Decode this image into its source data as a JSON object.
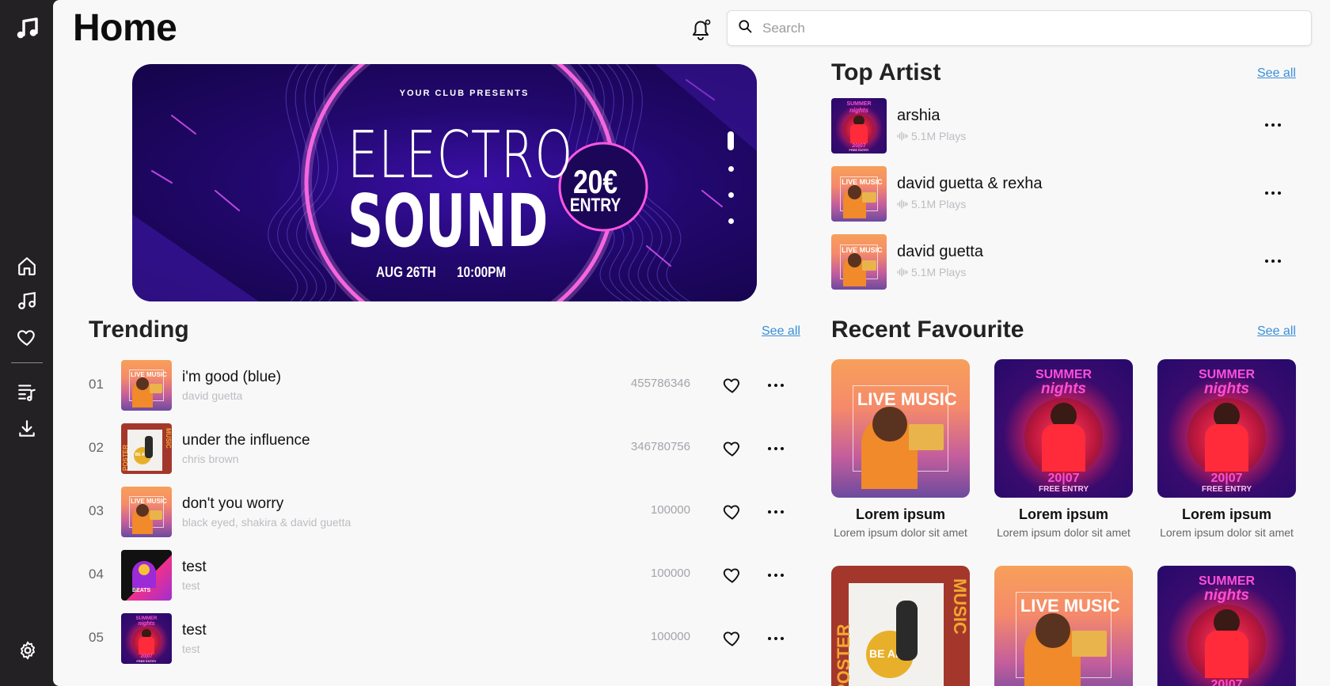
{
  "app": {
    "title": "Home"
  },
  "search": {
    "placeholder": "Search"
  },
  "banner": {
    "presents": "YOUR CLUB PRESENTS",
    "line1": "ELECTRO",
    "line2": "SOUND",
    "price": "20€",
    "entry": "ENTRY",
    "date": "AUG 26TH",
    "time": "10:00PM"
  },
  "trending": {
    "title": "Trending",
    "see_all": "See all",
    "items": [
      {
        "num": "01",
        "title": "i'm good (blue)",
        "artist": "david guetta",
        "plays": "455786346",
        "art": "live"
      },
      {
        "num": "02",
        "title": "under the influence",
        "artist": "chris brown",
        "plays": "346780756",
        "art": "poster"
      },
      {
        "num": "03",
        "title": "don't you worry",
        "artist": "black eyed, shakira & david guetta",
        "plays": "100000",
        "art": "live"
      },
      {
        "num": "04",
        "title": "test",
        "artist": "test",
        "plays": "100000",
        "art": "beats"
      },
      {
        "num": "05",
        "title": "test",
        "artist": "test",
        "plays": "100000",
        "art": "summer"
      }
    ]
  },
  "top_artist": {
    "title": "Top Artist",
    "see_all": "See all",
    "items": [
      {
        "name": "arshia",
        "plays": "5.1M Plays",
        "art": "summer"
      },
      {
        "name": "david guetta & rexha",
        "plays": "5.1M Plays",
        "art": "live"
      },
      {
        "name": "david guetta",
        "plays": "5.1M Plays",
        "art": "live"
      }
    ]
  },
  "recent_favourite": {
    "title": "Recent Favourite",
    "see_all": "See all",
    "items": [
      {
        "title": "Lorem ipsum",
        "subtitle": "Lorem ipsum dolor sit amet",
        "art": "live"
      },
      {
        "title": "Lorem ipsum",
        "subtitle": "Lorem ipsum dolor sit amet",
        "art": "summer"
      },
      {
        "title": "Lorem ipsum",
        "subtitle": "Lorem ipsum dolor sit amet",
        "art": "summer"
      },
      {
        "title": "",
        "subtitle": "",
        "art": "poster"
      },
      {
        "title": "",
        "subtitle": "",
        "art": "live"
      },
      {
        "title": "",
        "subtitle": "",
        "art": "summer"
      }
    ]
  },
  "poster_text": {
    "live_music": "LIVE MUSIC",
    "summer": "SUMMER",
    "nights": "nights",
    "summer_date": "20|07",
    "free_entry": "FREE ENTRY",
    "poster_word": "POSTER",
    "music_word": "MUSIC",
    "be_art": "BE ART",
    "beats": "BEATS"
  },
  "colors": {
    "sidebar": "#232124",
    "background": "#f8f8f9",
    "link": "#3a8fd6",
    "banner_purple": "#22086e",
    "neon_pink": "#ff4fd8"
  },
  "icons": {
    "sidebar_logo": "music-note-icon",
    "nav": [
      "home-icon",
      "music-icon",
      "heart-icon",
      "playlist-icon",
      "download-icon",
      "settings-icon"
    ],
    "header": [
      "bell-icon",
      "search-icon"
    ],
    "row": [
      "heart-icon",
      "more-icon"
    ]
  }
}
